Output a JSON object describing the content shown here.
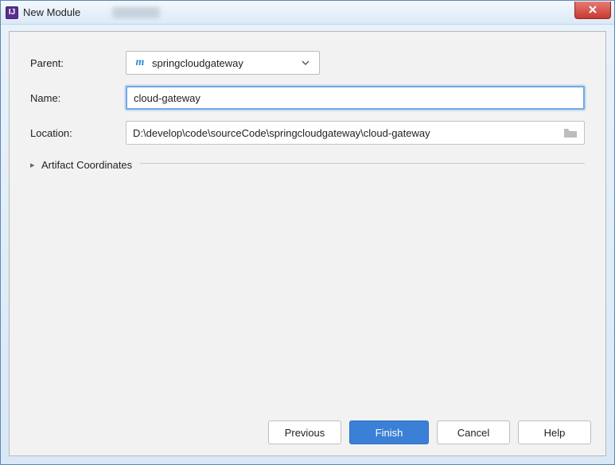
{
  "window": {
    "title": "New Module"
  },
  "form": {
    "parent_label": "Parent:",
    "parent_value": "springcloudgateway",
    "name_label": "Name:",
    "name_value": "cloud-gateway",
    "location_label": "Location:",
    "location_value": "D:\\develop\\code\\sourceCode\\springcloudgateway\\cloud-gateway",
    "expander_label": "Artifact Coordinates"
  },
  "buttons": {
    "previous": "Previous",
    "finish": "Finish",
    "cancel": "Cancel",
    "help": "Help"
  }
}
